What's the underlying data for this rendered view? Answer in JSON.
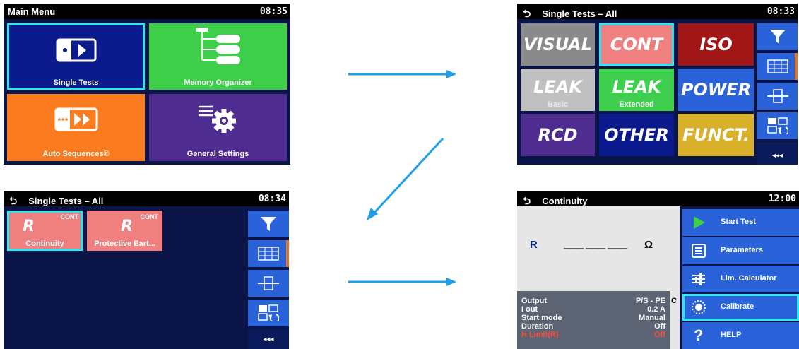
{
  "main_menu": {
    "title": "Main Menu",
    "time": "08:35",
    "tiles": [
      {
        "label": "Single Tests",
        "icon": "single-tests-icon",
        "color": "#0b1a8c"
      },
      {
        "label": "Memory Organizer",
        "icon": "memory-organizer-icon",
        "color": "#3fce4a"
      },
      {
        "label": "Auto Sequences®",
        "icon": "auto-sequences-icon",
        "color": "#fb7c1e"
      },
      {
        "label": "General Settings",
        "icon": "gear-icon",
        "color": "#4f2c8f"
      }
    ]
  },
  "single_tests_all": {
    "title": "Single Tests – All",
    "time": "08:33",
    "tiles": [
      {
        "label": "VISUAL",
        "sub": "",
        "color": "#8a8a8a"
      },
      {
        "label": "CONT",
        "sub": "",
        "color": "#f08080"
      },
      {
        "label": "ISO",
        "sub": "",
        "color": "#a11616"
      },
      {
        "label": "LEAK",
        "sub": "Basic",
        "color": "#c0c0c0"
      },
      {
        "label": "LEAK",
        "sub": "Extended",
        "color": "#3dcf4d"
      },
      {
        "label": "POWER",
        "sub": "",
        "color": "#2a63d9"
      },
      {
        "label": "RCD",
        "sub": "",
        "color": "#4f2c8f"
      },
      {
        "label": "OTHER",
        "sub": "",
        "color": "#0b1a8c"
      },
      {
        "label": "FUNCT.",
        "sub": "",
        "color": "#d8b02a"
      }
    ],
    "side_more": "◂◂◂"
  },
  "single_tests_filtered": {
    "title": "Single Tests – All",
    "time": "08:34",
    "tiles": [
      {
        "letter": "R",
        "tag": "CONT",
        "label": "Continuity"
      },
      {
        "letter": "R",
        "tag": "CONT",
        "label": "Protective Eart..."
      }
    ],
    "side_more": "◂◂◂"
  },
  "continuity": {
    "title": "Continuity",
    "time": "12:00",
    "result_label": "R",
    "result_value": "___ ___ ___",
    "result_unit": "Ω",
    "params": [
      {
        "name": "Output",
        "value": "P/S - PE"
      },
      {
        "name": "I out",
        "value": "0.2 A"
      },
      {
        "name": "Start mode",
        "value": "Manual"
      },
      {
        "name": "Duration",
        "value": "Off"
      },
      {
        "name": "H Limit(R)",
        "value": "Off"
      }
    ],
    "c_mark": "C",
    "menu": [
      {
        "label": "Start Test",
        "icon": "play-icon"
      },
      {
        "label": "Parameters",
        "icon": "list-icon"
      },
      {
        "label": "Lim. Calculator",
        "icon": "sliders-icon"
      },
      {
        "label": "Calibrate",
        "icon": "calibrate-icon"
      },
      {
        "label": "HELP",
        "icon": "help-icon"
      }
    ]
  }
}
